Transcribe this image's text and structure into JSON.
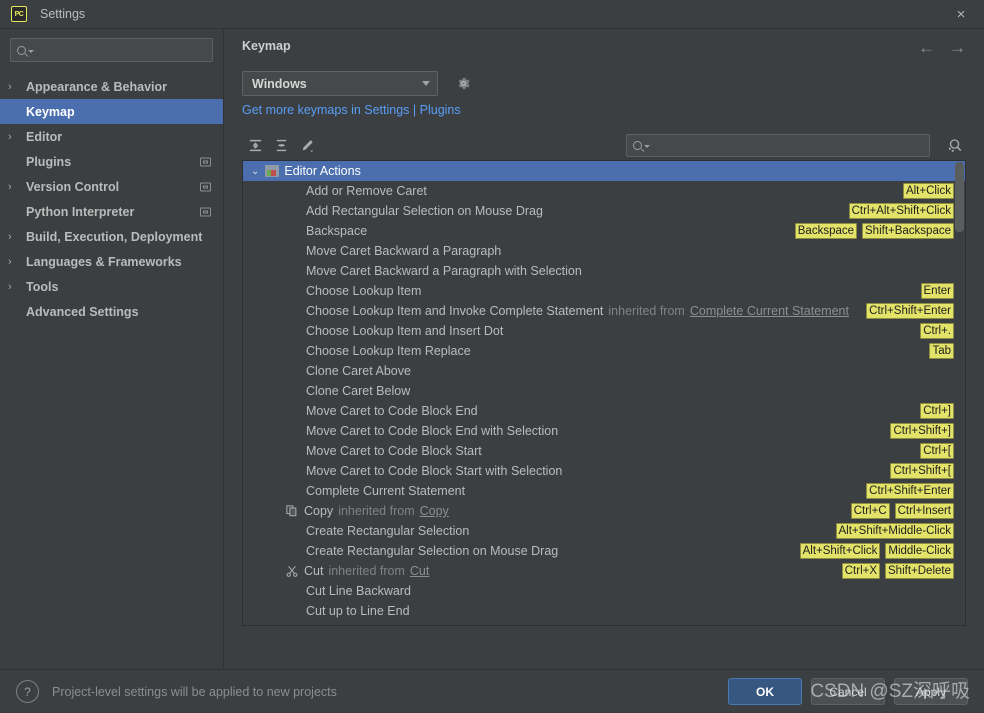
{
  "window": {
    "title": "Settings",
    "logo_text": "PC",
    "close_icon": "×"
  },
  "sidebar": {
    "search_placeholder": "",
    "items": [
      {
        "label": "Appearance & Behavior",
        "arrow": "›",
        "expandable": true,
        "selected": false,
        "badge": false
      },
      {
        "label": "Keymap",
        "arrow": "",
        "expandable": false,
        "selected": true,
        "badge": false
      },
      {
        "label": "Editor",
        "arrow": "›",
        "expandable": true,
        "selected": false,
        "badge": false
      },
      {
        "label": "Plugins",
        "arrow": "",
        "expandable": false,
        "selected": false,
        "badge": true
      },
      {
        "label": "Version Control",
        "arrow": "›",
        "expandable": true,
        "selected": false,
        "badge": true
      },
      {
        "label": "Python Interpreter",
        "arrow": "",
        "expandable": false,
        "selected": false,
        "badge": true
      },
      {
        "label": "Build, Execution, Deployment",
        "arrow": "›",
        "expandable": true,
        "selected": false,
        "badge": false
      },
      {
        "label": "Languages & Frameworks",
        "arrow": "›",
        "expandable": true,
        "selected": false,
        "badge": false
      },
      {
        "label": "Tools",
        "arrow": "›",
        "expandable": true,
        "selected": false,
        "badge": false
      },
      {
        "label": "Advanced Settings",
        "arrow": "",
        "expandable": false,
        "selected": false,
        "badge": false
      }
    ]
  },
  "panel": {
    "title": "Keymap",
    "back_icon": "←",
    "forward_icon": "→",
    "keymap_selected": "Windows",
    "gear_icon": "gear-icon",
    "plugins_link": "Get more keymaps in Settings | Plugins"
  },
  "toolbar": {
    "expand_all_icon": "expand-all-icon",
    "collapse_all_icon": "collapse-all-icon",
    "edit_icon": "edit-icon",
    "search_placeholder": "",
    "find_shortcut_icon": "find-by-shortcut-icon"
  },
  "tree": {
    "group": {
      "label": "Editor Actions",
      "caret": "⌄",
      "icon": "editor-actions-icon"
    },
    "rows": [
      {
        "label": "Add or Remove Caret",
        "icon": "",
        "inherited_from": "",
        "shortcuts": [
          "Alt+Click"
        ]
      },
      {
        "label": "Add Rectangular Selection on Mouse Drag",
        "icon": "",
        "inherited_from": "",
        "shortcuts": [
          "Ctrl+Alt+Shift+Click"
        ]
      },
      {
        "label": "Backspace",
        "icon": "",
        "inherited_from": "",
        "shortcuts": [
          "Backspace",
          "Shift+Backspace"
        ]
      },
      {
        "label": "Move Caret Backward a Paragraph",
        "icon": "",
        "inherited_from": "",
        "shortcuts": []
      },
      {
        "label": "Move Caret Backward a Paragraph with Selection",
        "icon": "",
        "inherited_from": "",
        "shortcuts": []
      },
      {
        "label": "Choose Lookup Item",
        "icon": "",
        "inherited_from": "",
        "shortcuts": [
          "Enter"
        ]
      },
      {
        "label": "Choose Lookup Item and Invoke Complete Statement",
        "icon": "",
        "inherited_from": "Complete Current Statement",
        "shortcuts": [
          "Ctrl+Shift+Enter"
        ]
      },
      {
        "label": "Choose Lookup Item and Insert Dot",
        "icon": "",
        "inherited_from": "",
        "shortcuts": [
          "Ctrl+."
        ]
      },
      {
        "label": "Choose Lookup Item Replace",
        "icon": "",
        "inherited_from": "",
        "shortcuts": [
          "Tab"
        ]
      },
      {
        "label": "Clone Caret Above",
        "icon": "",
        "inherited_from": "",
        "shortcuts": []
      },
      {
        "label": "Clone Caret Below",
        "icon": "",
        "inherited_from": "",
        "shortcuts": []
      },
      {
        "label": "Move Caret to Code Block End",
        "icon": "",
        "inherited_from": "",
        "shortcuts": [
          "Ctrl+]"
        ]
      },
      {
        "label": "Move Caret to Code Block End with Selection",
        "icon": "",
        "inherited_from": "",
        "shortcuts": [
          "Ctrl+Shift+]"
        ]
      },
      {
        "label": "Move Caret to Code Block Start",
        "icon": "",
        "inherited_from": "",
        "shortcuts": [
          "Ctrl+["
        ]
      },
      {
        "label": "Move Caret to Code Block Start with Selection",
        "icon": "",
        "inherited_from": "",
        "shortcuts": [
          "Ctrl+Shift+["
        ]
      },
      {
        "label": "Complete Current Statement",
        "icon": "",
        "inherited_from": "",
        "shortcuts": [
          "Ctrl+Shift+Enter"
        ]
      },
      {
        "label": "Copy",
        "icon": "copy-icon",
        "inherited_from": "Copy",
        "shortcuts": [
          "Ctrl+C",
          "Ctrl+Insert"
        ]
      },
      {
        "label": "Create Rectangular Selection",
        "icon": "",
        "inherited_from": "",
        "shortcuts": [
          "Alt+Shift+Middle-Click"
        ]
      },
      {
        "label": "Create Rectangular Selection on Mouse Drag",
        "icon": "",
        "inherited_from": "",
        "shortcuts": [
          "Alt+Shift+Click",
          "Middle-Click"
        ]
      },
      {
        "label": "Cut",
        "icon": "cut-icon",
        "inherited_from": "Cut",
        "shortcuts": [
          "Ctrl+X",
          "Shift+Delete"
        ]
      },
      {
        "label": "Cut Line Backward",
        "icon": "",
        "inherited_from": "",
        "shortcuts": []
      },
      {
        "label": "Cut up to Line End",
        "icon": "",
        "inherited_from": "",
        "shortcuts": []
      }
    ],
    "inherited_prefix": "inherited from"
  },
  "footer": {
    "help_icon": "?",
    "note": "Project-level settings will be applied to new projects",
    "ok_label": "OK",
    "cancel_label": "Cancel",
    "apply_label": "Apply"
  },
  "watermark": "CSDN @SZ深呼吸",
  "colors": {
    "accent_selection": "#4b6eaf",
    "link": "#589df6",
    "shortcut_badge": "#e3e36a",
    "primary_button": "#365880",
    "window_bg": "#3c3f41"
  }
}
